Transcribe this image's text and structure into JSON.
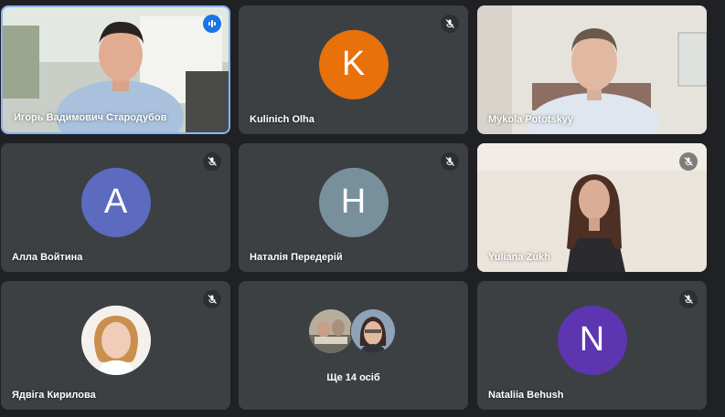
{
  "participants": [
    {
      "name": "Игорь Вадимович Стародубов",
      "status": "speaking"
    },
    {
      "name": "Kulinich Olha",
      "initial": "K",
      "avatar_color": "#e8710a",
      "status": "muted"
    },
    {
      "name": "Mykola Pototskyy",
      "status": "video"
    },
    {
      "name": "Алла Войтина",
      "initial": "A",
      "avatar_color": "#5c6bc0",
      "status": "muted"
    },
    {
      "name": "Наталія Передерій",
      "initial": "H",
      "avatar_color": "#78909c",
      "status": "muted"
    },
    {
      "name": "Yuliana Zukh",
      "status": "muted"
    },
    {
      "name": "Ядвіга Кирилова",
      "status": "muted"
    },
    {
      "name": "Nataliia Behush",
      "initial": "N",
      "avatar_color": "#5e35b1",
      "status": "muted"
    }
  ],
  "more": {
    "label": "Ще 14 осіб"
  },
  "icons": {
    "muted": "mic-off-icon",
    "speaking": "audio-level-icon"
  }
}
